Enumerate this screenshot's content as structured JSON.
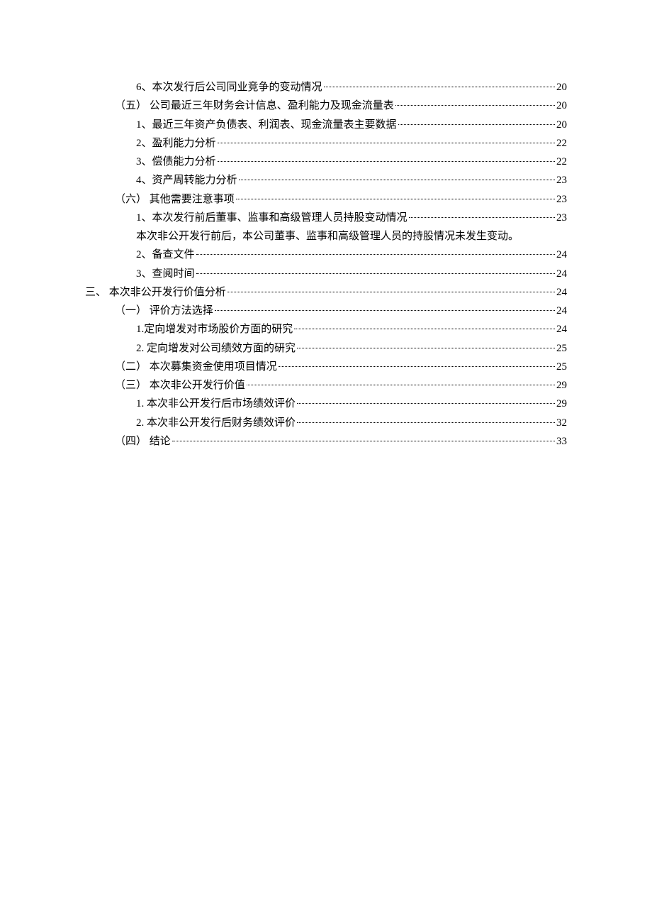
{
  "toc": [
    {
      "indent": 2,
      "text": "6、本次发行后公司同业竞争的变动情况",
      "page": "20"
    },
    {
      "indent": 1,
      "text": "（五） 公司最近三年财务会计信息、盈利能力及现金流量表",
      "page": "20"
    },
    {
      "indent": 2,
      "text": "1、最近三年资产负债表、利润表、现金流量表主要数据",
      "page": "20"
    },
    {
      "indent": 2,
      "text": "2、盈利能力分析",
      "page": "22"
    },
    {
      "indent": 2,
      "text": "3、偿债能力分析",
      "page": "22"
    },
    {
      "indent": 2,
      "text": "4、资产周转能力分析",
      "page": "23"
    },
    {
      "indent": 1,
      "text": "（六） 其他需要注意事项",
      "page": "23"
    },
    {
      "indent": 2,
      "text": "1、本次发行前后董事、监事和高级管理人员持股变动情况",
      "page": "23"
    },
    {
      "indent": 2,
      "text": "本次非公开发行前后，本公司董事、监事和高级管理人员的持股情况未发生变动。",
      "page": ""
    },
    {
      "indent": 2,
      "text": "2、备查文件",
      "page": "24"
    },
    {
      "indent": 2,
      "text": "3、查阅时间",
      "page": "24"
    },
    {
      "indent": 0,
      "text": "三、 本次非公开发行价值分析",
      "page": "24"
    },
    {
      "indent": 1,
      "text": "（一） 评价方法选择",
      "page": "24"
    },
    {
      "indent": 2,
      "text": "1.定向增发对市场股价方面的研究",
      "page": "24"
    },
    {
      "indent": 2,
      "text": "2. 定向增发对公司绩效方面的研究",
      "page": "25"
    },
    {
      "indent": 1,
      "text": "（二） 本次募集资金使用项目情况",
      "page": "25"
    },
    {
      "indent": 1,
      "text": "（三） 本次非公开发行价值",
      "page": "29"
    },
    {
      "indent": 2,
      "text": "1. 本次非公开发行后市场绩效评价",
      "page": "29"
    },
    {
      "indent": 2,
      "text": "2. 本次非公开发行后财务绩效评价",
      "page": "32"
    },
    {
      "indent": 1,
      "text": "（四） 结论",
      "page": "33"
    }
  ]
}
